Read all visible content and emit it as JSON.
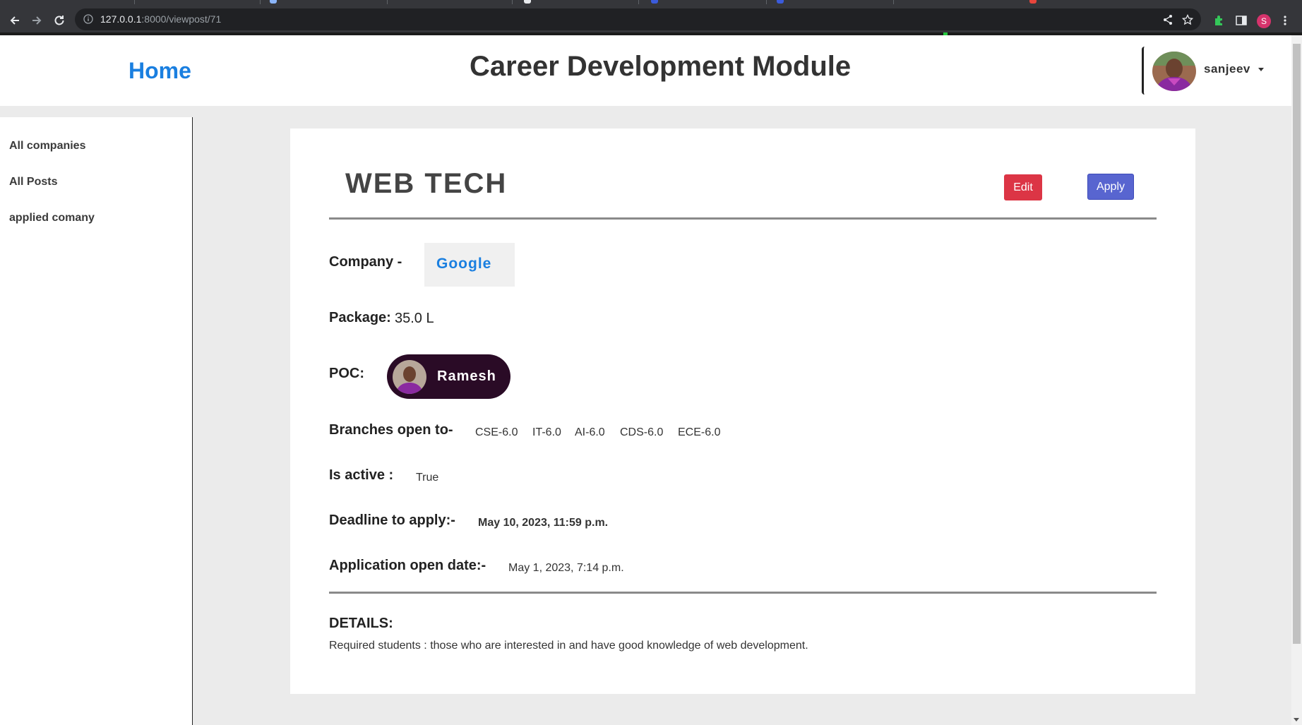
{
  "browser": {
    "url_host": "127.0.0.1",
    "url_path": ":8000/viewpost/71",
    "profile_initial": "S"
  },
  "header": {
    "home_label": "Home",
    "title": "Career Development Module",
    "user_name": "sanjeev"
  },
  "sidebar": {
    "items": [
      {
        "label": "All companies"
      },
      {
        "label": "All Posts"
      },
      {
        "label": "applied comany"
      }
    ]
  },
  "post": {
    "title": "WEB TECH",
    "edit_label": "Edit",
    "apply_label": "Apply",
    "company_label": "Company -",
    "company_name": "Google",
    "package_label": "Package:",
    "package_value": "35.0 L",
    "poc_label": "POC:",
    "poc_name": "Ramesh",
    "branches_label": "Branches open to-",
    "branches": [
      "CSE-6.0",
      "IT-6.0",
      "AI-6.0",
      "CDS-6.0",
      "ECE-6.0"
    ],
    "active_label": "Is active :",
    "active_value": "True",
    "deadline_label": "Deadline to apply:-",
    "deadline_value": "May 10, 2023, 11:59 p.m.",
    "open_date_label": "Application open date:-",
    "open_date_value": "May 1, 2023, 7:14 p.m.",
    "details_label": "DETAILS:",
    "details_text": "Required students : those who are interested in and have good knowledge of web development."
  },
  "colors": {
    "accent_blue": "#1a7fe0",
    "edit_red": "#dc3545",
    "apply_blue": "#5865d0",
    "poc_pill": "#2a0b26"
  }
}
